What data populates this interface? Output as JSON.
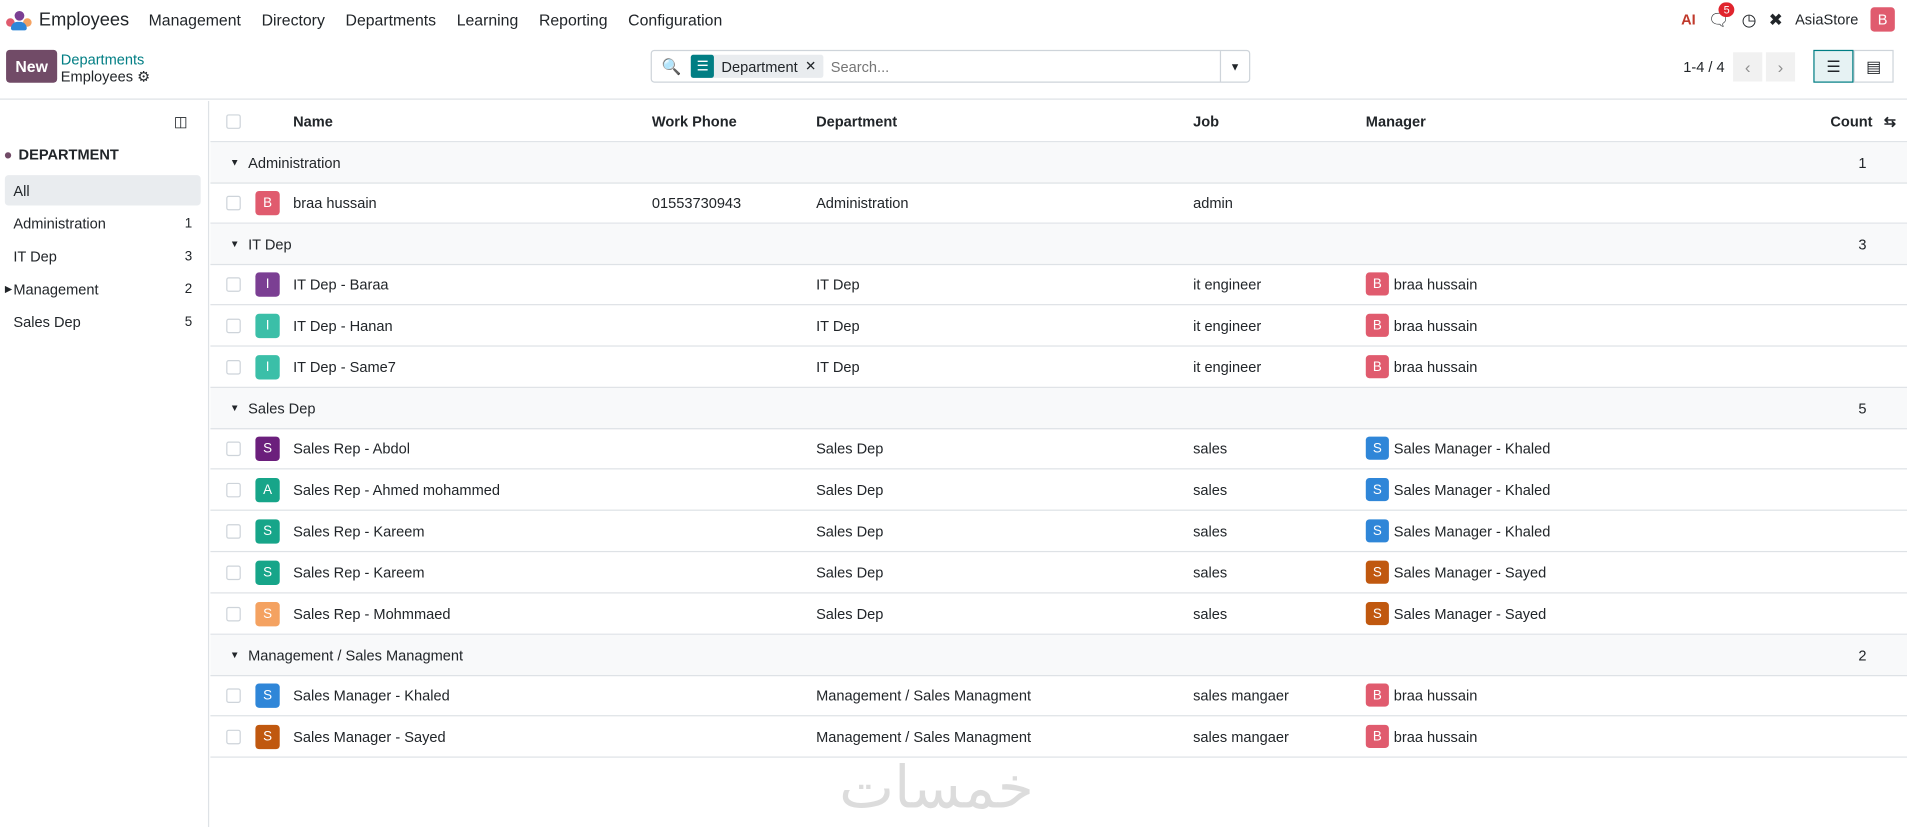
{
  "app": {
    "name": "Employees",
    "menu": [
      "Management",
      "Directory",
      "Departments",
      "Learning",
      "Reporting",
      "Configuration"
    ],
    "company": "AsiaStore",
    "user_initial": "B",
    "chat_count": "5",
    "ai_label": "AI"
  },
  "control": {
    "new_label": "New",
    "breadcrumb_parent": "Departments",
    "breadcrumb_current": "Employees",
    "facet_label": "Department",
    "search_placeholder": "Search...",
    "pager": "1-4 / 4"
  },
  "sidebar": {
    "title": "DEPARTMENT",
    "items": [
      {
        "label": "All",
        "count": ""
      },
      {
        "label": "Administration",
        "count": "1"
      },
      {
        "label": "IT Dep",
        "count": "3"
      },
      {
        "label": "Management",
        "count": "2"
      },
      {
        "label": "Sales Dep",
        "count": "5"
      }
    ]
  },
  "table": {
    "headers": {
      "name": "Name",
      "phone": "Work Phone",
      "dept": "Department",
      "job": "Job",
      "manager": "Manager",
      "count": "Count"
    },
    "groups": [
      {
        "label": "Administration",
        "count": "1",
        "rows": [
          {
            "initial": "B",
            "color": "#e05b6e",
            "name": "braa hussain",
            "phone": "01553730943",
            "dept": "Administration",
            "job": "admin",
            "mgr": "",
            "mgr_initial": "",
            "mgr_color": ""
          }
        ]
      },
      {
        "label": "IT Dep",
        "count": "3",
        "rows": [
          {
            "initial": "I",
            "color": "#7b3f93",
            "name": "IT Dep - Baraa",
            "phone": "",
            "dept": "IT Dep",
            "job": "it engineer",
            "mgr": "braa hussain",
            "mgr_initial": "B",
            "mgr_color": "#e05b6e"
          },
          {
            "initial": "I",
            "color": "#3bbfa8",
            "name": "IT Dep - Hanan",
            "phone": "",
            "dept": "IT Dep",
            "job": "it engineer",
            "mgr": "braa hussain",
            "mgr_initial": "B",
            "mgr_color": "#e05b6e"
          },
          {
            "initial": "I",
            "color": "#3bbfa8",
            "name": "IT Dep - Same7",
            "phone": "",
            "dept": "IT Dep",
            "job": "it engineer",
            "mgr": "braa hussain",
            "mgr_initial": "B",
            "mgr_color": "#e05b6e"
          }
        ]
      },
      {
        "label": "Sales Dep",
        "count": "5",
        "rows": [
          {
            "initial": "S",
            "color": "#6b1f7c",
            "name": "Sales Rep - Abdol",
            "phone": "",
            "dept": "Sales Dep",
            "job": "sales",
            "mgr": "Sales Manager - Khaled",
            "mgr_initial": "S",
            "mgr_color": "#2f86d8"
          },
          {
            "initial": "A",
            "color": "#17a589",
            "name": "Sales Rep - Ahmed mohammed",
            "phone": "",
            "dept": "Sales Dep",
            "job": "sales",
            "mgr": "Sales Manager - Khaled",
            "mgr_initial": "S",
            "mgr_color": "#2f86d8"
          },
          {
            "initial": "S",
            "color": "#17a589",
            "name": "Sales Rep - Kareem",
            "phone": "",
            "dept": "Sales Dep",
            "job": "sales",
            "mgr": "Sales Manager - Khaled",
            "mgr_initial": "S",
            "mgr_color": "#2f86d8"
          },
          {
            "initial": "S",
            "color": "#17a589",
            "name": "Sales Rep - Kareem",
            "phone": "",
            "dept": "Sales Dep",
            "job": "sales",
            "mgr": "Sales Manager - Sayed",
            "mgr_initial": "S",
            "mgr_color": "#c0580f"
          },
          {
            "initial": "S",
            "color": "#f4a261",
            "name": "Sales Rep - Mohmmaed",
            "phone": "",
            "dept": "Sales Dep",
            "job": "sales",
            "mgr": "Sales Manager - Sayed",
            "mgr_initial": "S",
            "mgr_color": "#c0580f"
          }
        ]
      },
      {
        "label": "Management / Sales Managment",
        "count": "2",
        "rows": [
          {
            "initial": "S",
            "color": "#2f86d8",
            "name": "Sales Manager - Khaled",
            "phone": "",
            "dept": "Management / Sales Managment",
            "job": "sales mangaer",
            "mgr": "braa hussain",
            "mgr_initial": "B",
            "mgr_color": "#e05b6e"
          },
          {
            "initial": "S",
            "color": "#c0580f",
            "name": "Sales Manager - Sayed",
            "phone": "",
            "dept": "Management / Sales Managment",
            "job": "sales mangaer",
            "mgr": "braa hussain",
            "mgr_initial": "B",
            "mgr_color": "#e05b6e"
          }
        ]
      }
    ]
  },
  "watermark": "خمسات"
}
